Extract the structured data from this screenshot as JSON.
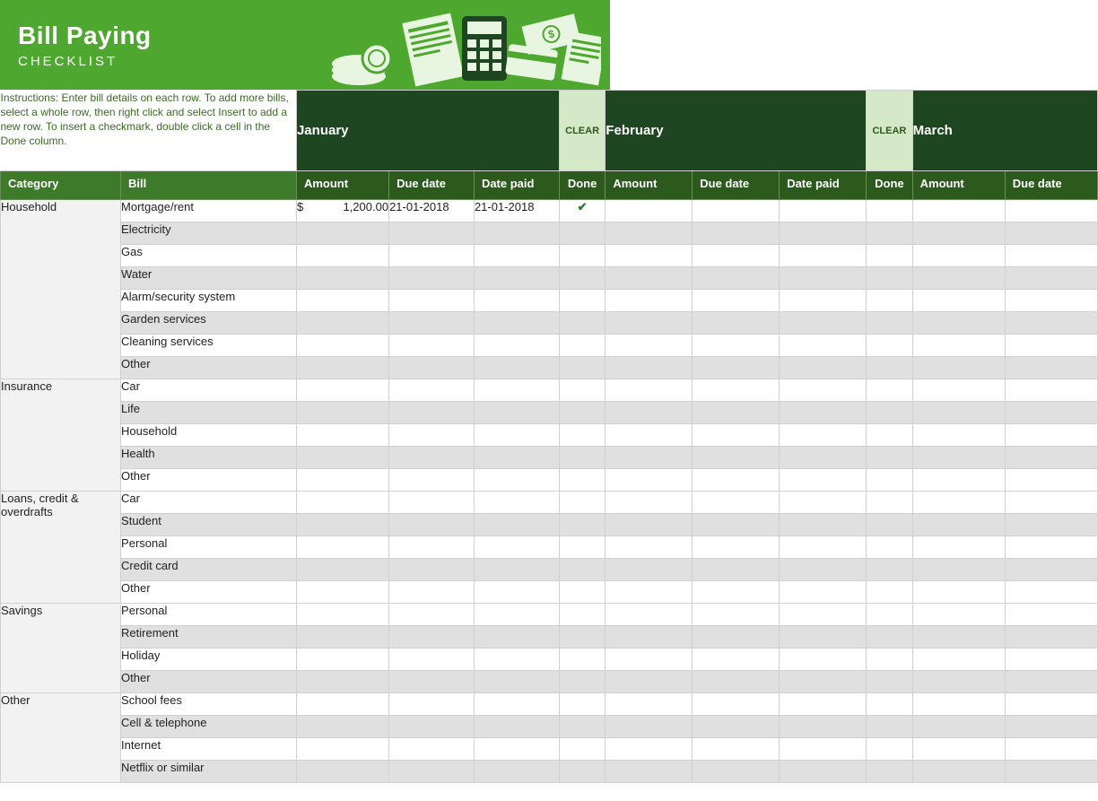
{
  "header": {
    "title": "Bill Paying",
    "subtitle": "CHECKLIST"
  },
  "instructions": "Instructions: Enter bill details on each row. To add more bills, select a whole row, then right click and select Insert to add a new row. To insert a checkmark, double click a cell in the Done column.",
  "months": [
    {
      "name": "January",
      "clear": "CLEAR"
    },
    {
      "name": "February",
      "clear": "CLEAR"
    },
    {
      "name": "March",
      "clear": ""
    }
  ],
  "columns": {
    "category": "Category",
    "bill": "Bill",
    "amount": "Amount",
    "due": "Due date",
    "paid": "Date paid",
    "done": "Done"
  },
  "categories": [
    {
      "name": "Household",
      "bills": [
        {
          "name": "Mortgage/rent",
          "jan": {
            "amount": "1,200.00",
            "due": "21-01-2018",
            "paid": "21-01-2018",
            "done": true
          }
        },
        {
          "name": "Electricity"
        },
        {
          "name": "Gas"
        },
        {
          "name": "Water"
        },
        {
          "name": "Alarm/security system"
        },
        {
          "name": "Garden services"
        },
        {
          "name": "Cleaning services"
        },
        {
          "name": "Other"
        }
      ]
    },
    {
      "name": "Insurance",
      "bills": [
        {
          "name": "Car"
        },
        {
          "name": "Life"
        },
        {
          "name": "Household"
        },
        {
          "name": "Health"
        },
        {
          "name": "Other"
        }
      ]
    },
    {
      "name": "Loans, credit & overdrafts",
      "bills": [
        {
          "name": "Car"
        },
        {
          "name": "Student"
        },
        {
          "name": "Personal"
        },
        {
          "name": "Credit card"
        },
        {
          "name": "Other"
        }
      ]
    },
    {
      "name": "Savings",
      "bills": [
        {
          "name": "Personal"
        },
        {
          "name": "Retirement"
        },
        {
          "name": "Holiday"
        },
        {
          "name": "Other"
        }
      ]
    },
    {
      "name": "Other",
      "bills": [
        {
          "name": "School fees"
        },
        {
          "name": "Cell & telephone"
        },
        {
          "name": "Internet"
        },
        {
          "name": "Netflix or similar"
        }
      ]
    }
  ]
}
